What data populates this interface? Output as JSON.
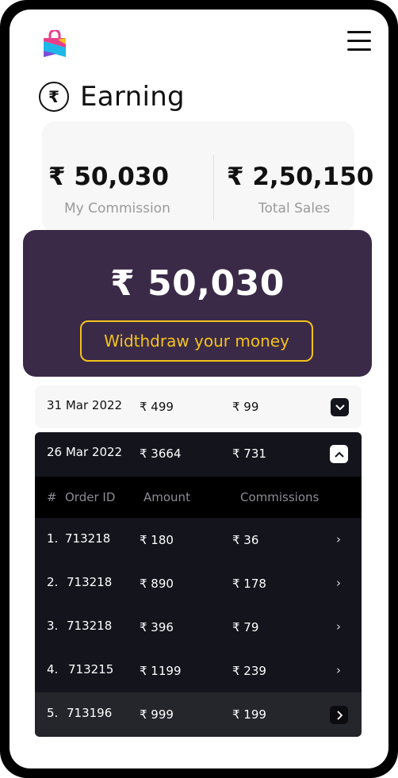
{
  "header": {
    "title": "Earning",
    "currency_icon": "rupee-icon",
    "menu_icon": "hamburger-menu-icon",
    "logo_icon": "shopping-bag-logo-icon"
  },
  "stats": {
    "commission_value": "₹ 50,030",
    "commission_label": "My Commission",
    "sales_value": "₹ 2,50,150",
    "sales_label": "Total Sales"
  },
  "balance": {
    "value": "₹ 50,030",
    "withdraw_label": "Widthdraw your money",
    "withdraw_color": "#f4c21b",
    "card_color": "#3a2a48"
  },
  "groups": [
    {
      "date": "31 Mar 2022",
      "amount": "₹ 499",
      "commission": "₹ 99",
      "expanded": false
    },
    {
      "date": "26 Mar 2022",
      "amount": "₹ 3664",
      "commission": "₹ 731",
      "expanded": true,
      "columns": [
        "#",
        "Order ID",
        "Amount",
        "Commissions"
      ],
      "orders": [
        {
          "index": "1.",
          "order_id": "713218",
          "amount": "₹ 180",
          "commission": "₹ 36"
        },
        {
          "index": "2.",
          "order_id": "713218",
          "amount": "₹ 890",
          "commission": "₹ 178"
        },
        {
          "index": "3.",
          "order_id": "713218",
          "amount": "₹ 396",
          "commission": "₹ 79"
        },
        {
          "index": "4.",
          "order_id": "713215",
          "amount": "₹ 1199",
          "commission": "₹ 239"
        },
        {
          "index": "5.",
          "order_id": "713196",
          "amount": "₹ 999",
          "commission": "₹ 199"
        }
      ]
    }
  ]
}
